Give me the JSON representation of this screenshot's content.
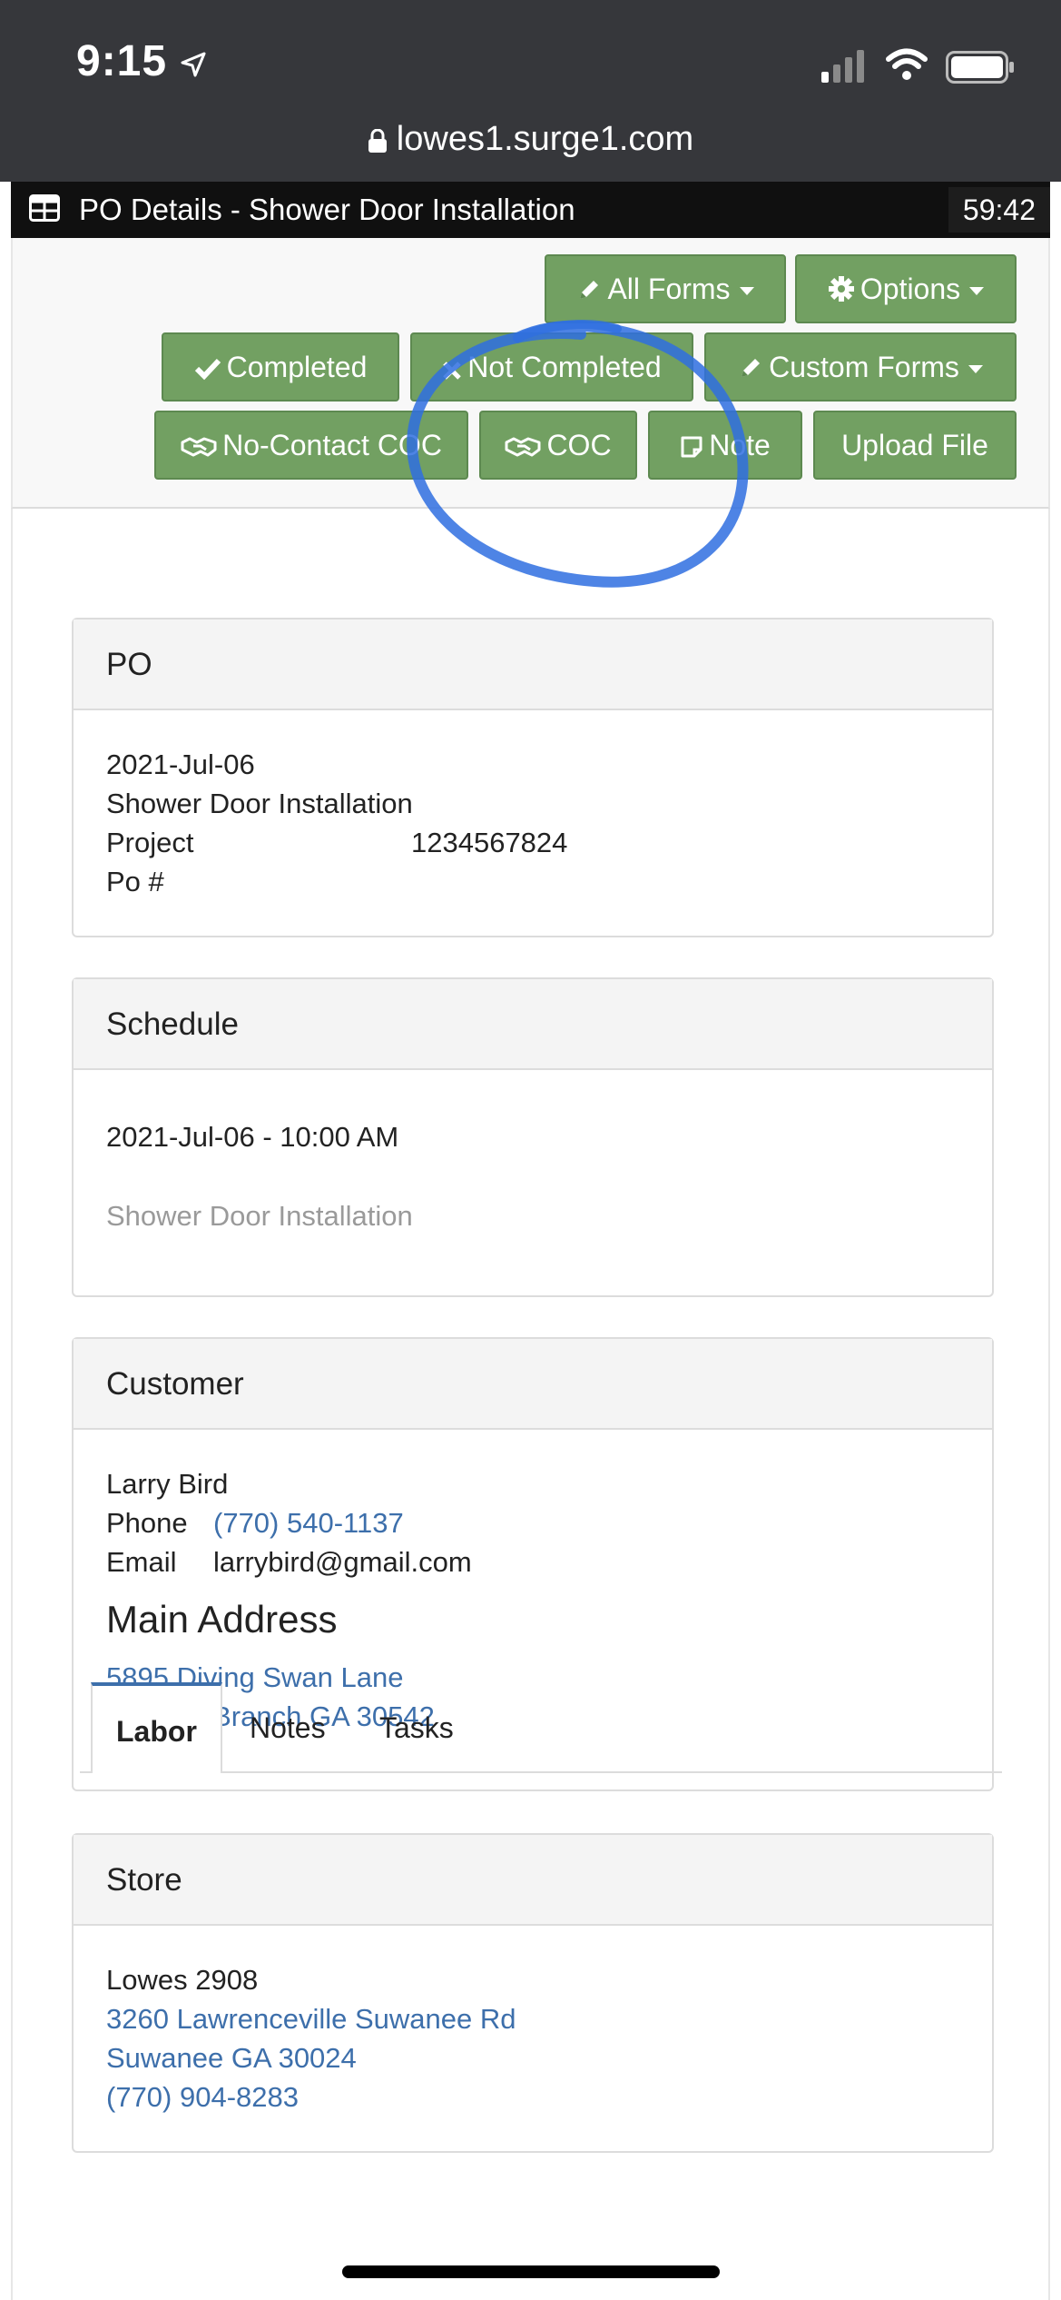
{
  "status_bar": {
    "time": "9:15",
    "url": "lowes1.surge1.com"
  },
  "title_bar": {
    "title": "PO Details - Shower Door Installation",
    "timer": "59:42"
  },
  "toolbar": {
    "all_forms": "All Forms",
    "options": "Options",
    "completed": "Completed",
    "not_completed": "Not Completed",
    "custom_forms": "Custom Forms",
    "no_contact_coc": "No-Contact COC",
    "coc": "COC",
    "note": "Note",
    "upload_file": "Upload File"
  },
  "po_panel": {
    "heading": "PO",
    "date": "2021-Jul-06",
    "service": "Shower Door Installation",
    "project_label": "Project",
    "project_value": "1234567824",
    "po_label": "Po #"
  },
  "schedule_panel": {
    "heading": "Schedule",
    "datetime": "2021-Jul-06 - 10:00 AM",
    "service": "Shower Door Installation"
  },
  "customer_panel": {
    "heading": "Customer",
    "name": "Larry Bird",
    "phone_label": "Phone",
    "phone": "(770) 540-1137",
    "email_label": "Email",
    "email": "larrybird@gmail.com",
    "address_heading": "Main Address",
    "address_line1": "5895 Diving Swan Lane",
    "address_line2": "Flowery Branch GA 30542"
  },
  "store_panel": {
    "heading": "Store",
    "name": "Lowes 2908",
    "address_line1": "3260 Lawrenceville Suwanee Rd",
    "address_line2": "Suwanee GA 30024",
    "phone": "(770) 904-8283"
  },
  "tabs": [
    {
      "label": "Labor",
      "active": true
    },
    {
      "label": "Notes",
      "active": false
    },
    {
      "label": "Tasks",
      "active": false
    }
  ],
  "colors": {
    "button_green": "#72a062",
    "link_blue": "#3d6fab",
    "annotation_blue": "#2f6fe0"
  }
}
